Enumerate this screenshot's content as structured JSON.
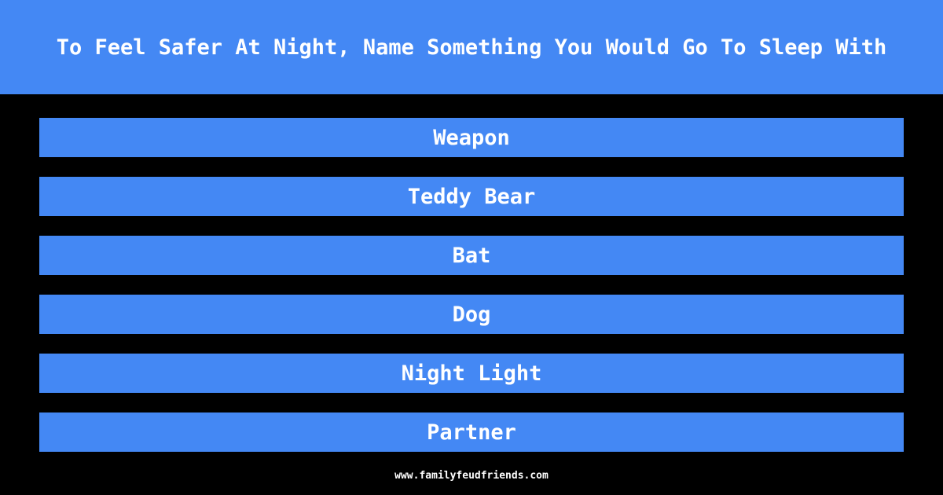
{
  "header": {
    "title": "To Feel Safer At Night, Name Something You Would Go To Sleep With"
  },
  "answers": [
    "Weapon",
    "Teddy Bear",
    "Bat",
    "Dog",
    "Night Light",
    "Partner"
  ],
  "footer": {
    "site": "www.familyfeudfriends.com"
  },
  "colors": {
    "accent": "#4488f4",
    "background": "#000000",
    "text": "#ffffff"
  }
}
